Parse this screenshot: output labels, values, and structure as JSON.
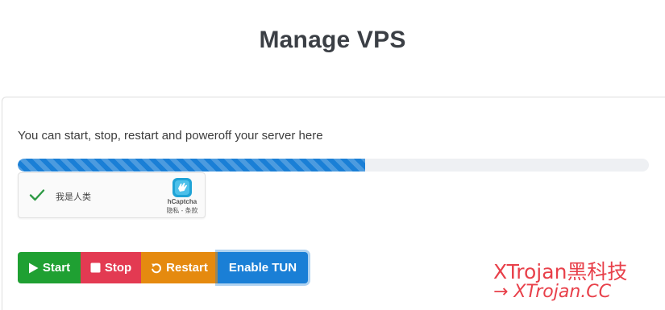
{
  "page": {
    "title": "Manage VPS"
  },
  "panel": {
    "description": "You can start, stop, restart and poweroff your server here",
    "progress": {
      "value": 0.55,
      "color": "#1a7fd6"
    }
  },
  "captcha": {
    "label": "我是人类",
    "brand": "hCaptcha",
    "links": "隐私 - 条款",
    "check_icon": "checkmark-icon",
    "logo_icon": "hcaptcha-logo-icon"
  },
  "actions": {
    "start": {
      "label": "Start",
      "icon": "play-icon",
      "color": "#1fa032"
    },
    "stop": {
      "label": "Stop",
      "icon": "stop-square-icon",
      "color": "#e33a52"
    },
    "restart": {
      "label": "Restart",
      "icon": "restart-icon",
      "color": "#e58a0f"
    },
    "tun": {
      "label": "Enable TUN",
      "color": "#1a7fd6"
    }
  },
  "watermark": {
    "title": "XTrojan黑科技",
    "url": "→ XTrojan.CC",
    "color": "#e8404a"
  }
}
